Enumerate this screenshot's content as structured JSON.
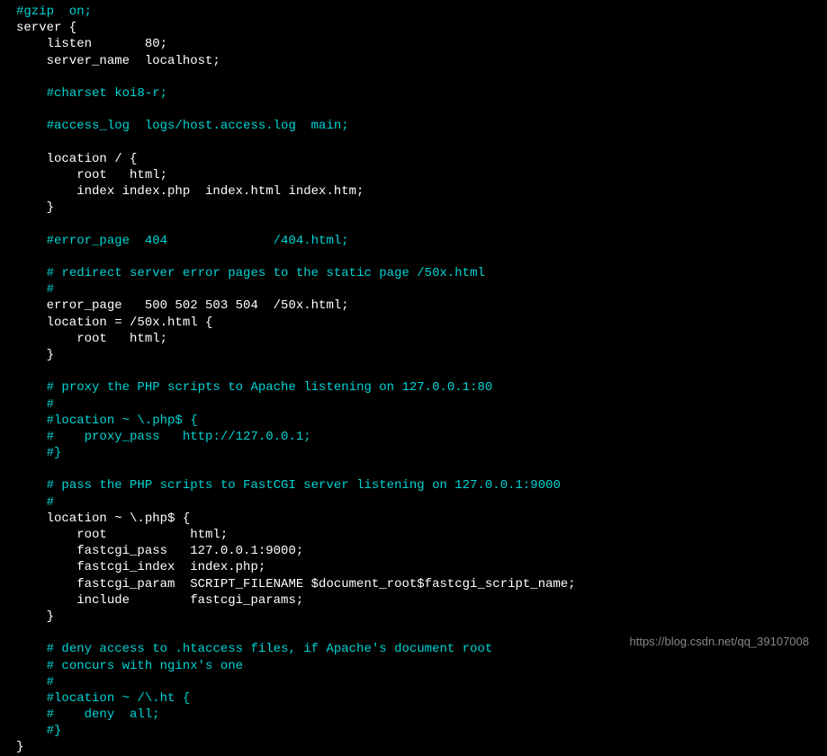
{
  "lines": [
    {
      "segments": [
        {
          "type": "comment",
          "text": "#gzip  on;"
        }
      ]
    },
    {
      "segments": [
        {
          "type": "code",
          "text": "server {"
        }
      ]
    },
    {
      "segments": [
        {
          "type": "code",
          "text": "    listen       80;"
        }
      ]
    },
    {
      "segments": [
        {
          "type": "code",
          "text": "    server_name  localhost;"
        }
      ]
    },
    {
      "segments": [
        {
          "type": "code",
          "text": ""
        }
      ]
    },
    {
      "segments": [
        {
          "type": "code",
          "text": "    "
        },
        {
          "type": "comment",
          "text": "#charset koi8-r;"
        }
      ]
    },
    {
      "segments": [
        {
          "type": "code",
          "text": ""
        }
      ]
    },
    {
      "segments": [
        {
          "type": "code",
          "text": "    "
        },
        {
          "type": "comment",
          "text": "#access_log  logs/host.access.log  main;"
        }
      ]
    },
    {
      "segments": [
        {
          "type": "code",
          "text": ""
        }
      ]
    },
    {
      "segments": [
        {
          "type": "code",
          "text": "    location / {"
        }
      ]
    },
    {
      "segments": [
        {
          "type": "code",
          "text": "        root   html;"
        }
      ]
    },
    {
      "segments": [
        {
          "type": "code",
          "text": "        index index.php  index.html index.htm;"
        }
      ]
    },
    {
      "segments": [
        {
          "type": "code",
          "text": "    }"
        }
      ]
    },
    {
      "segments": [
        {
          "type": "code",
          "text": ""
        }
      ]
    },
    {
      "segments": [
        {
          "type": "code",
          "text": "    "
        },
        {
          "type": "comment",
          "text": "#error_page  404              /404.html;"
        }
      ]
    },
    {
      "segments": [
        {
          "type": "code",
          "text": ""
        }
      ]
    },
    {
      "segments": [
        {
          "type": "code",
          "text": "    "
        },
        {
          "type": "comment",
          "text": "# redirect server error pages to the static page /50x.html"
        }
      ]
    },
    {
      "segments": [
        {
          "type": "code",
          "text": "    "
        },
        {
          "type": "comment",
          "text": "#"
        }
      ]
    },
    {
      "segments": [
        {
          "type": "code",
          "text": "    error_page   500 502 503 504  /50x.html;"
        }
      ]
    },
    {
      "segments": [
        {
          "type": "code",
          "text": "    location = /50x.html {"
        }
      ]
    },
    {
      "segments": [
        {
          "type": "code",
          "text": "        root   html;"
        }
      ]
    },
    {
      "segments": [
        {
          "type": "code",
          "text": "    }"
        }
      ]
    },
    {
      "segments": [
        {
          "type": "code",
          "text": ""
        }
      ]
    },
    {
      "segments": [
        {
          "type": "code",
          "text": "    "
        },
        {
          "type": "comment",
          "text": "# proxy the PHP scripts to Apache listening on 127.0.0.1:80"
        }
      ]
    },
    {
      "segments": [
        {
          "type": "code",
          "text": "    "
        },
        {
          "type": "comment",
          "text": "#"
        }
      ]
    },
    {
      "segments": [
        {
          "type": "code",
          "text": "    "
        },
        {
          "type": "comment",
          "text": "#location ~ \\.php$ {"
        }
      ]
    },
    {
      "segments": [
        {
          "type": "code",
          "text": "    "
        },
        {
          "type": "comment",
          "text": "#    proxy_pass   http://127.0.0.1;"
        }
      ]
    },
    {
      "segments": [
        {
          "type": "code",
          "text": "    "
        },
        {
          "type": "comment",
          "text": "#}"
        }
      ]
    },
    {
      "segments": [
        {
          "type": "code",
          "text": ""
        }
      ]
    },
    {
      "segments": [
        {
          "type": "code",
          "text": "    "
        },
        {
          "type": "comment",
          "text": "# pass the PHP scripts to FastCGI server listening on 127.0.0.1:9000"
        }
      ]
    },
    {
      "segments": [
        {
          "type": "code",
          "text": "    "
        },
        {
          "type": "comment",
          "text": "#"
        }
      ]
    },
    {
      "segments": [
        {
          "type": "code",
          "text": "    location ~ \\.php$ {"
        }
      ]
    },
    {
      "segments": [
        {
          "type": "code",
          "text": "        root           html;"
        }
      ]
    },
    {
      "segments": [
        {
          "type": "code",
          "text": "        fastcgi_pass   127.0.0.1:9000;"
        }
      ]
    },
    {
      "segments": [
        {
          "type": "code",
          "text": "        fastcgi_index  index.php;"
        }
      ]
    },
    {
      "segments": [
        {
          "type": "code",
          "text": "        fastcgi_param  SCRIPT_FILENAME $document_root$fastcgi_script_name;"
        }
      ]
    },
    {
      "segments": [
        {
          "type": "code",
          "text": "        include        fastcgi_params;"
        }
      ]
    },
    {
      "segments": [
        {
          "type": "code",
          "text": "    }"
        }
      ]
    },
    {
      "segments": [
        {
          "type": "code",
          "text": ""
        }
      ]
    },
    {
      "segments": [
        {
          "type": "code",
          "text": "    "
        },
        {
          "type": "comment",
          "text": "# deny access to .htaccess files, if Apache's document root"
        }
      ]
    },
    {
      "segments": [
        {
          "type": "code",
          "text": "    "
        },
        {
          "type": "comment",
          "text": "# concurs with nginx's one"
        }
      ]
    },
    {
      "segments": [
        {
          "type": "code",
          "text": "    "
        },
        {
          "type": "comment",
          "text": "#"
        }
      ]
    },
    {
      "segments": [
        {
          "type": "code",
          "text": "    "
        },
        {
          "type": "comment",
          "text": "#location ~ /\\.ht {"
        }
      ]
    },
    {
      "segments": [
        {
          "type": "code",
          "text": "    "
        },
        {
          "type": "comment",
          "text": "#    deny  all;"
        }
      ]
    },
    {
      "segments": [
        {
          "type": "code",
          "text": "    "
        },
        {
          "type": "comment",
          "text": "#}"
        }
      ]
    },
    {
      "segments": [
        {
          "type": "code",
          "text": "}"
        }
      ]
    }
  ],
  "watermark": "https://blog.csdn.net/qq_39107008"
}
